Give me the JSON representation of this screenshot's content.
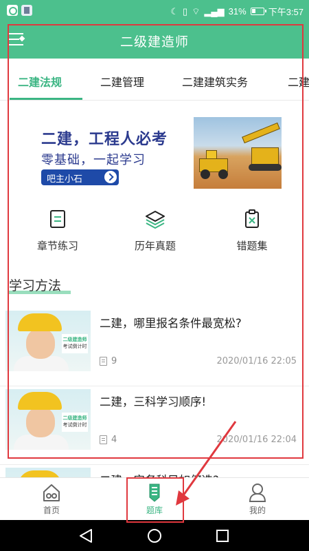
{
  "status_bar": {
    "signal": "31%",
    "time": "下午3:57",
    "icons": [
      "notification-app-icon",
      "notification-app-icon-2",
      "moon-icon",
      "vibrate-icon",
      "wifi-icon",
      "signal-icon",
      "battery-icon"
    ]
  },
  "app_bar": {
    "title": "二级建造师",
    "menu_icon": "menu-icon"
  },
  "tabs": [
    {
      "label": "二建法规",
      "active": true
    },
    {
      "label": "二建管理",
      "active": false
    },
    {
      "label": "二建建筑实务",
      "active": false
    },
    {
      "label": "二建",
      "active": false
    }
  ],
  "banner": {
    "headline": "二建，工程人必考",
    "subline": "零基础，一起学习",
    "button_label": "吧主小石"
  },
  "quick_actions": [
    {
      "label": "章节练习",
      "icon": "document-icon"
    },
    {
      "label": "历年真题",
      "icon": "layers-icon"
    },
    {
      "label": "错题集",
      "icon": "clipboard-x-icon"
    }
  ],
  "section": {
    "title": "学习方法"
  },
  "articles": [
    {
      "title": "二建，哪里报名条件最宽松?",
      "count": "9",
      "date": "2020/01/16 22:05",
      "thumb_title": "二级建造师",
      "thumb_sub": "考试倒计时"
    },
    {
      "title": "二建，三科学习顺序!",
      "count": "4",
      "date": "2020/01/16 22:04",
      "thumb_title": "二级建造师",
      "thumb_sub": "考试倒计时"
    },
    {
      "title": "二建，实务科目如何选?",
      "count": "",
      "date": "",
      "thumb_title": "",
      "thumb_sub": ""
    }
  ],
  "bottom_nav": [
    {
      "label": "首页",
      "icon": "home-icon",
      "active": false
    },
    {
      "label": "题库",
      "icon": "pencil-icon",
      "active": true
    },
    {
      "label": "我的",
      "icon": "person-icon",
      "active": false
    }
  ],
  "colors": {
    "brand_green": "#4cc08d",
    "accent_green": "#3bb583",
    "banner_blue": "#2b3a8e",
    "annotation_red": "#e0383e"
  }
}
